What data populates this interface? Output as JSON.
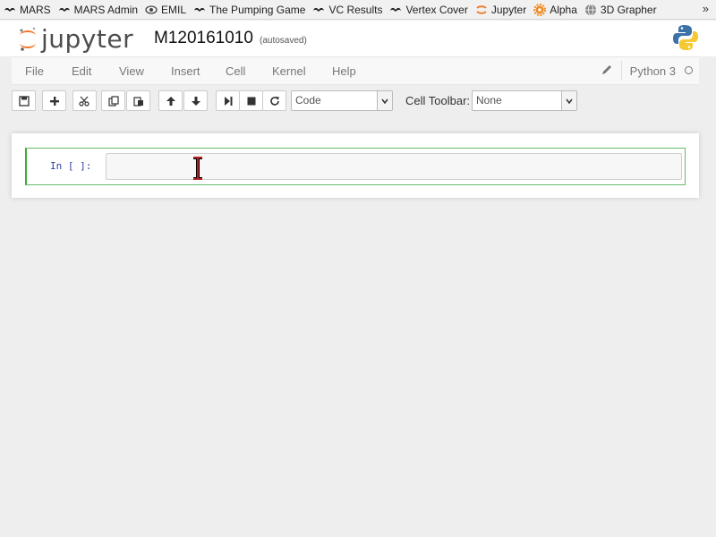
{
  "bookmarks": [
    {
      "label": "MARS",
      "icon": "mustache-icon"
    },
    {
      "label": "MARS Admin",
      "icon": "mustache-icon"
    },
    {
      "label": "EMIL",
      "icon": "eye-icon"
    },
    {
      "label": "The Pumping Game",
      "icon": "mustache-icon"
    },
    {
      "label": "VC Results",
      "icon": "mustache-icon"
    },
    {
      "label": "Vertex Cover",
      "icon": "mustache-icon"
    },
    {
      "label": "Jupyter",
      "icon": "jupyter-icon"
    },
    {
      "label": "Alpha",
      "icon": "gear-icon"
    },
    {
      "label": "3D Grapher",
      "icon": "globe-icon"
    }
  ],
  "bookmarks_overflow": "»",
  "header": {
    "logo_text": "jupyter",
    "notebook_name": "M120161010",
    "autosave_status": "(autosaved)"
  },
  "menu": {
    "items": [
      "File",
      "Edit",
      "View",
      "Insert",
      "Cell",
      "Kernel",
      "Help"
    ],
    "kernel_name": "Python 3"
  },
  "toolbar": {
    "cell_type": "Code",
    "cell_toolbar_label": "Cell Toolbar:",
    "cell_toolbar_value": "None"
  },
  "cell": {
    "prompt": "In [ ]:",
    "source": ""
  },
  "colors": {
    "jupyter_orange": "#f37626",
    "cell_border_selected": "#66bb6a",
    "prompt_blue": "#303f9f"
  }
}
